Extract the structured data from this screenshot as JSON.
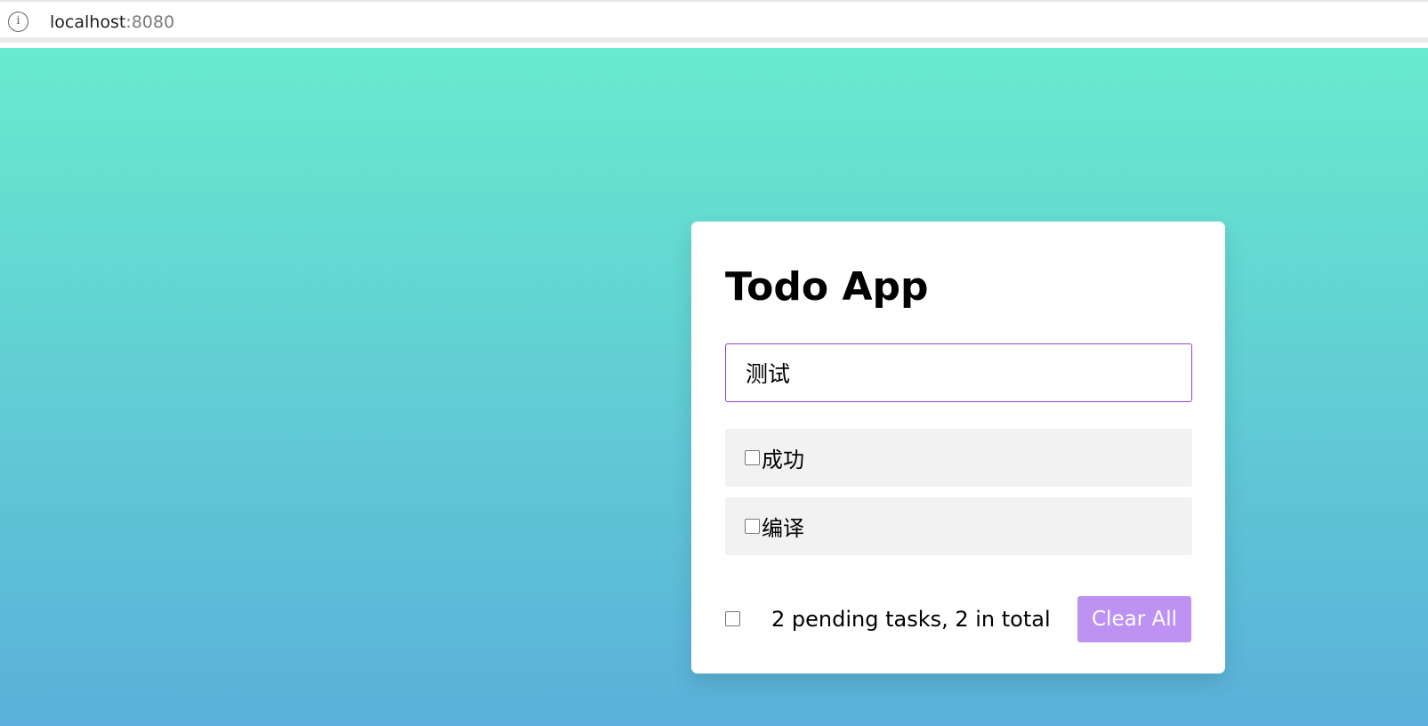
{
  "browser": {
    "url_host": "localhost",
    "url_port": ":8080",
    "info_icon": "info-icon",
    "info_glyph": "i"
  },
  "app": {
    "title": "Todo App",
    "input_value": "测试",
    "todos": [
      {
        "label": "成功",
        "checked": false
      },
      {
        "label": "编译",
        "checked": false
      }
    ],
    "footer": {
      "pending_text": "2 pending tasks, 2 in total",
      "clear_label": "Clear All"
    }
  },
  "colors": {
    "gradient_top": "#68ebce",
    "gradient_bottom": "#5ab0da",
    "input_border": "#8e44d6",
    "button_bg": "#bd92f2",
    "item_bg": "#f2f2f2"
  }
}
